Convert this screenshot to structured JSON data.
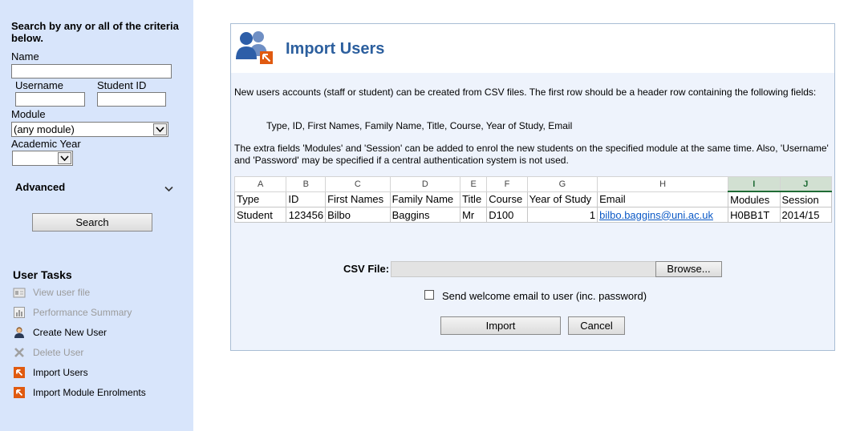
{
  "sidebar": {
    "title": "Search by any or all of the criteria below.",
    "name_label": "Name",
    "username_label": "Username",
    "student_id_label": "Student ID",
    "module_label": "Module",
    "module_value": "(any module)",
    "academic_year_label": "Academic Year",
    "academic_year_value": "",
    "advanced_label": "Advanced",
    "search_button": "Search",
    "tasks_title": "User Tasks",
    "tasks": [
      {
        "label": "View user file",
        "icon": "user-file-icon",
        "enabled": false
      },
      {
        "label": "Performance Summary",
        "icon": "performance-chart-icon",
        "enabled": false
      },
      {
        "label": "Create New User",
        "icon": "new-user-icon",
        "enabled": true
      },
      {
        "label": "Delete User",
        "icon": "delete-x-icon",
        "enabled": false
      },
      {
        "label": "Import Users",
        "icon": "import-icon",
        "enabled": true
      },
      {
        "label": "Import Module Enrolments",
        "icon": "import-icon",
        "enabled": true
      }
    ]
  },
  "main": {
    "title": "Import Users",
    "intro": "New users accounts (staff or student) can be created from CSV files. The first row should be a header row containing the following fields:",
    "fields_line": "Type, ID, First Names, Family Name, Title, Course, Year of Study, Email",
    "extra_text": "The extra fields 'Modules' and 'Session' can be added to enrol the new students on the specified module at the same time. Also, 'Username' and 'Password' may be specified if a central authentication system is not used.",
    "sheet": {
      "col_letters": [
        "A",
        "B",
        "C",
        "D",
        "E",
        "F",
        "G",
        "H",
        "I",
        "J"
      ],
      "headers": [
        "Type",
        "ID",
        "First Names",
        "Family Name",
        "Title",
        "Course",
        "Year of Study",
        "Email",
        "Modules",
        "Session"
      ],
      "row": [
        "Student",
        "123456",
        "Bilbo",
        "Baggins",
        "Mr",
        "D100",
        "1",
        "bilbo.baggins@uni.ac.uk",
        "H0BB1T",
        "2014/15"
      ]
    },
    "csv_label": "CSV File:",
    "csv_value": "",
    "browse_button": "Browse...",
    "welcome_label": "Send welcome email to user (inc. password)",
    "welcome_checked": false,
    "import_button": "Import",
    "cancel_button": "Cancel"
  },
  "colors": {
    "sidebar_bg": "#d8e5fb",
    "title_blue": "#2c5f9e",
    "import_orange": "#e05a10"
  }
}
